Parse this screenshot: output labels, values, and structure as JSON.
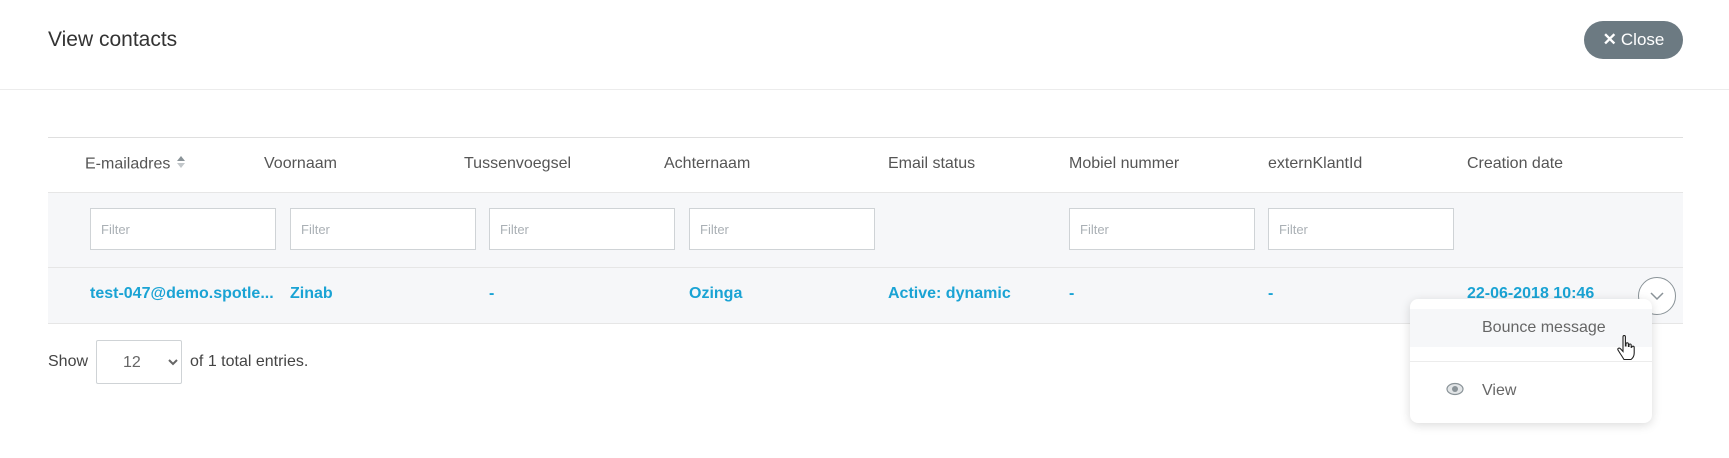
{
  "header": {
    "title": "View contacts",
    "close_label": "Close",
    "close_icon": "close-icon"
  },
  "table": {
    "columns": [
      "E-mailadres",
      "Voornaam",
      "Tussenvoegsel",
      "Achternaam",
      "Email status",
      "Mobiel nummer",
      "externKlantId",
      "Creation date"
    ],
    "filter_placeholder": "Filter",
    "rows": [
      {
        "email": "test-047@demo.spotle...",
        "voornaam": "Zinab",
        "tussenvoegsel": "-",
        "achternaam": "Ozinga",
        "email_status": "Active: dynamic",
        "mobiel": "-",
        "extern_klant_id": "-",
        "creation_date": "22-06-2018 10:46"
      }
    ]
  },
  "footer": {
    "show_label": "Show",
    "page_size": "12",
    "page_size_options": [
      "12"
    ],
    "entries_label": "of 1 total entries."
  },
  "row_menu": {
    "items": [
      {
        "label": "Bounce message",
        "icon": ""
      },
      {
        "label": "View",
        "icon": "eye-icon"
      }
    ]
  },
  "colors": {
    "link": "#1aa3d4",
    "close_button": "#6c7a82",
    "row_background": "#f6f7f9"
  }
}
